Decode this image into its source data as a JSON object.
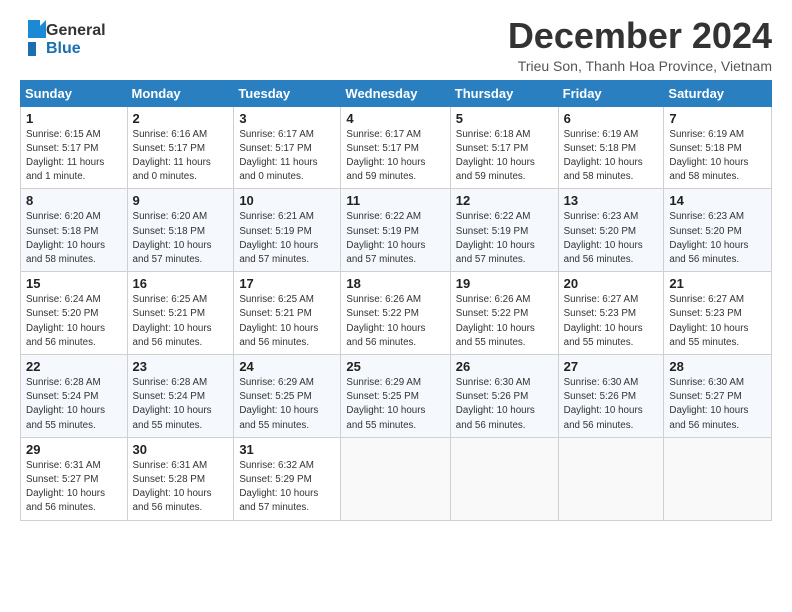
{
  "header": {
    "logo_line1": "General",
    "logo_line2": "Blue",
    "month_title": "December 2024",
    "location": "Trieu Son, Thanh Hoa Province, Vietnam"
  },
  "days_of_week": [
    "Sunday",
    "Monday",
    "Tuesday",
    "Wednesday",
    "Thursday",
    "Friday",
    "Saturday"
  ],
  "weeks": [
    [
      {
        "day": 1,
        "info": "Sunrise: 6:15 AM\nSunset: 5:17 PM\nDaylight: 11 hours\nand 1 minute."
      },
      {
        "day": 2,
        "info": "Sunrise: 6:16 AM\nSunset: 5:17 PM\nDaylight: 11 hours\nand 0 minutes."
      },
      {
        "day": 3,
        "info": "Sunrise: 6:17 AM\nSunset: 5:17 PM\nDaylight: 11 hours\nand 0 minutes."
      },
      {
        "day": 4,
        "info": "Sunrise: 6:17 AM\nSunset: 5:17 PM\nDaylight: 10 hours\nand 59 minutes."
      },
      {
        "day": 5,
        "info": "Sunrise: 6:18 AM\nSunset: 5:17 PM\nDaylight: 10 hours\nand 59 minutes."
      },
      {
        "day": 6,
        "info": "Sunrise: 6:19 AM\nSunset: 5:18 PM\nDaylight: 10 hours\nand 58 minutes."
      },
      {
        "day": 7,
        "info": "Sunrise: 6:19 AM\nSunset: 5:18 PM\nDaylight: 10 hours\nand 58 minutes."
      }
    ],
    [
      {
        "day": 8,
        "info": "Sunrise: 6:20 AM\nSunset: 5:18 PM\nDaylight: 10 hours\nand 58 minutes."
      },
      {
        "day": 9,
        "info": "Sunrise: 6:20 AM\nSunset: 5:18 PM\nDaylight: 10 hours\nand 57 minutes."
      },
      {
        "day": 10,
        "info": "Sunrise: 6:21 AM\nSunset: 5:19 PM\nDaylight: 10 hours\nand 57 minutes."
      },
      {
        "day": 11,
        "info": "Sunrise: 6:22 AM\nSunset: 5:19 PM\nDaylight: 10 hours\nand 57 minutes."
      },
      {
        "day": 12,
        "info": "Sunrise: 6:22 AM\nSunset: 5:19 PM\nDaylight: 10 hours\nand 57 minutes."
      },
      {
        "day": 13,
        "info": "Sunrise: 6:23 AM\nSunset: 5:20 PM\nDaylight: 10 hours\nand 56 minutes."
      },
      {
        "day": 14,
        "info": "Sunrise: 6:23 AM\nSunset: 5:20 PM\nDaylight: 10 hours\nand 56 minutes."
      }
    ],
    [
      {
        "day": 15,
        "info": "Sunrise: 6:24 AM\nSunset: 5:20 PM\nDaylight: 10 hours\nand 56 minutes."
      },
      {
        "day": 16,
        "info": "Sunrise: 6:25 AM\nSunset: 5:21 PM\nDaylight: 10 hours\nand 56 minutes."
      },
      {
        "day": 17,
        "info": "Sunrise: 6:25 AM\nSunset: 5:21 PM\nDaylight: 10 hours\nand 56 minutes."
      },
      {
        "day": 18,
        "info": "Sunrise: 6:26 AM\nSunset: 5:22 PM\nDaylight: 10 hours\nand 56 minutes."
      },
      {
        "day": 19,
        "info": "Sunrise: 6:26 AM\nSunset: 5:22 PM\nDaylight: 10 hours\nand 55 minutes."
      },
      {
        "day": 20,
        "info": "Sunrise: 6:27 AM\nSunset: 5:23 PM\nDaylight: 10 hours\nand 55 minutes."
      },
      {
        "day": 21,
        "info": "Sunrise: 6:27 AM\nSunset: 5:23 PM\nDaylight: 10 hours\nand 55 minutes."
      }
    ],
    [
      {
        "day": 22,
        "info": "Sunrise: 6:28 AM\nSunset: 5:24 PM\nDaylight: 10 hours\nand 55 minutes."
      },
      {
        "day": 23,
        "info": "Sunrise: 6:28 AM\nSunset: 5:24 PM\nDaylight: 10 hours\nand 55 minutes."
      },
      {
        "day": 24,
        "info": "Sunrise: 6:29 AM\nSunset: 5:25 PM\nDaylight: 10 hours\nand 55 minutes."
      },
      {
        "day": 25,
        "info": "Sunrise: 6:29 AM\nSunset: 5:25 PM\nDaylight: 10 hours\nand 55 minutes."
      },
      {
        "day": 26,
        "info": "Sunrise: 6:30 AM\nSunset: 5:26 PM\nDaylight: 10 hours\nand 56 minutes."
      },
      {
        "day": 27,
        "info": "Sunrise: 6:30 AM\nSunset: 5:26 PM\nDaylight: 10 hours\nand 56 minutes."
      },
      {
        "day": 28,
        "info": "Sunrise: 6:30 AM\nSunset: 5:27 PM\nDaylight: 10 hours\nand 56 minutes."
      }
    ],
    [
      {
        "day": 29,
        "info": "Sunrise: 6:31 AM\nSunset: 5:27 PM\nDaylight: 10 hours\nand 56 minutes."
      },
      {
        "day": 30,
        "info": "Sunrise: 6:31 AM\nSunset: 5:28 PM\nDaylight: 10 hours\nand 56 minutes."
      },
      {
        "day": 31,
        "info": "Sunrise: 6:32 AM\nSunset: 5:29 PM\nDaylight: 10 hours\nand 57 minutes."
      },
      null,
      null,
      null,
      null
    ]
  ]
}
